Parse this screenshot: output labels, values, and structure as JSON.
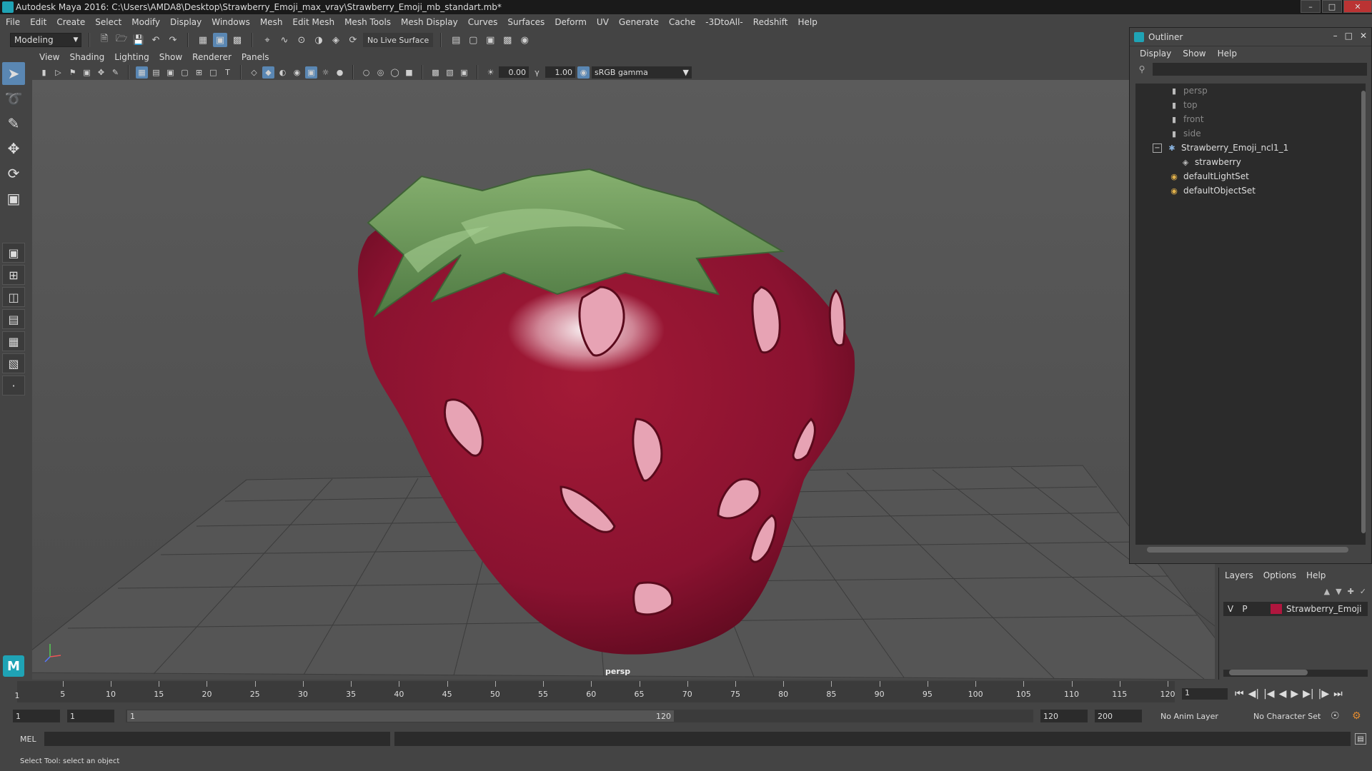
{
  "window": {
    "title": "Autodesk Maya 2016: C:\\Users\\AMDA8\\Desktop\\Strawberry_Emoji_max_vray\\Strawberry_Emoji_mb_standart.mb*"
  },
  "menubar": [
    "File",
    "Edit",
    "Create",
    "Select",
    "Modify",
    "Display",
    "Windows",
    "Mesh",
    "Edit Mesh",
    "Mesh Tools",
    "Mesh Display",
    "Curves",
    "Surfaces",
    "Deform",
    "UV",
    "Generate",
    "Cache",
    "-3DtoAll-",
    "Redshift",
    "Help"
  ],
  "statusline": {
    "mode": "Modeling",
    "live_surface": "No Live Surface"
  },
  "viewport": {
    "menus": [
      "View",
      "Shading",
      "Lighting",
      "Show",
      "Renderer",
      "Panels"
    ],
    "exposure": "0.00",
    "gamma": "1.00",
    "color_space": "sRGB gamma",
    "camera_label": "persp"
  },
  "outliner": {
    "title": "Outliner",
    "menus": [
      "Display",
      "Show",
      "Help"
    ],
    "items": [
      {
        "label": "persp",
        "icon": "camera-icon",
        "dim": true
      },
      {
        "label": "top",
        "icon": "camera-icon",
        "dim": true
      },
      {
        "label": "front",
        "icon": "camera-icon",
        "dim": true
      },
      {
        "label": "side",
        "icon": "camera-icon",
        "dim": true
      },
      {
        "label": "Strawberry_Emoji_ncl1_1",
        "icon": "group-icon",
        "dim": false
      },
      {
        "label": "strawberry",
        "icon": "mesh-icon",
        "dim": false
      },
      {
        "label": "defaultLightSet",
        "icon": "set-icon",
        "dim": false
      },
      {
        "label": "defaultObjectSet",
        "icon": "set-icon",
        "dim": false
      }
    ]
  },
  "layers": {
    "menus": [
      "Layers",
      "Options",
      "Help"
    ],
    "layer": {
      "v": "V",
      "p": "P",
      "name": "Strawberry_Emoji",
      "color": "#b0163e"
    }
  },
  "timeline": {
    "ticks": [
      "5",
      "10",
      "15",
      "20",
      "25",
      "30",
      "35",
      "40",
      "45",
      "50",
      "55",
      "60",
      "65",
      "70",
      "75",
      "80",
      "85",
      "90",
      "95",
      "100",
      "105",
      "110",
      "115",
      "120"
    ],
    "first_tick": "1",
    "current_frame": "1"
  },
  "range": {
    "start": "1",
    "playback_start": "1",
    "slider_start": "1",
    "slider_end": "120",
    "playback_end": "120",
    "end": "200",
    "anim_layer": "No Anim Layer",
    "character_set": "No Character Set"
  },
  "cmdline": {
    "mel_label": "MEL"
  },
  "helpline": {
    "text": "Select Tool: select an object"
  },
  "colors": {
    "accent": "#5a87b3",
    "maya_teal": "#1fa3b5",
    "strawberry_red": "#8e1430",
    "leaf_green": "#5f8f4f"
  }
}
